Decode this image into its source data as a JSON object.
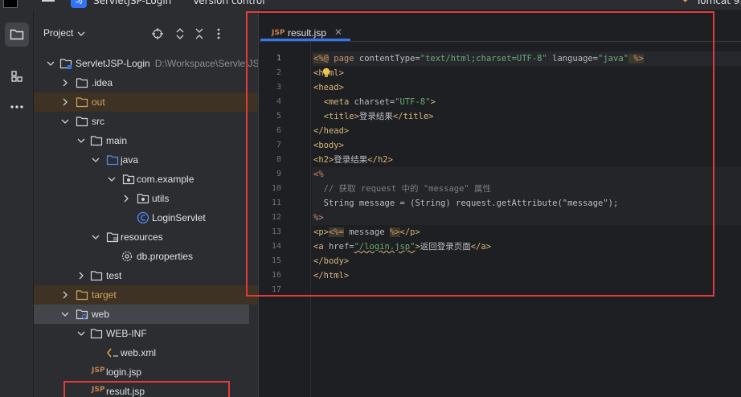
{
  "topbar": {
    "project_badge": "SJ",
    "project_name": "ServletJSP-Login",
    "vcs_label": "Version control",
    "run_config": "Tomcat 9."
  },
  "project_panel": {
    "title": "Project",
    "tree": [
      {
        "label": "ServletJSP-Login",
        "path": "D:\\Workspace\\ServletJSP",
        "type": "module",
        "expanded": true
      },
      {
        "label": ".idea",
        "type": "folder",
        "expanded": false
      },
      {
        "label": "out",
        "type": "folder-excluded",
        "expanded": false
      },
      {
        "label": "src",
        "type": "folder",
        "expanded": true
      },
      {
        "label": "main",
        "type": "folder",
        "expanded": true
      },
      {
        "label": "java",
        "type": "source-root",
        "expanded": true
      },
      {
        "label": "com.example",
        "type": "package",
        "expanded": true
      },
      {
        "label": "utils",
        "type": "package",
        "expanded": false
      },
      {
        "label": "LoginServlet",
        "type": "class"
      },
      {
        "label": "resources",
        "type": "resources-root",
        "expanded": true
      },
      {
        "label": "db.properties",
        "type": "properties"
      },
      {
        "label": "test",
        "type": "folder",
        "expanded": false
      },
      {
        "label": "target",
        "type": "folder-excluded",
        "expanded": false
      },
      {
        "label": "web",
        "type": "folder",
        "expanded": true
      },
      {
        "label": "WEB-INF",
        "type": "folder",
        "expanded": true
      },
      {
        "label": "web.xml",
        "type": "xml"
      },
      {
        "label": "login.jsp",
        "type": "jsp"
      },
      {
        "label": "result.jsp",
        "type": "jsp"
      }
    ]
  },
  "editor": {
    "tab_label": "result.jsp",
    "tab_file_type": "JSP",
    "lines": [
      "1",
      "2",
      "3",
      "4",
      "5",
      "6",
      "7",
      "8",
      "9",
      "10",
      "11",
      "12",
      "13",
      "14",
      "15",
      "16",
      "17"
    ],
    "code": {
      "l1_dir_open": "<%@",
      "l1_kw": " page ",
      "l1_attr1": "contentType=",
      "l1_str1": "\"text/html;charset=UTF-8\"",
      "l1_attr2": " language=",
      "l1_str2": "\"java\"",
      "l1_dir_close": " %>",
      "l2": "<html>",
      "l3": "<head>",
      "l4_tag_open": "<meta",
      "l4_attr": " charset=",
      "l4_str": "\"UTF-8\"",
      "l4_tag_close": ">",
      "l5_open": "<title>",
      "l5_text": "登录结果",
      "l5_close": "</title>",
      "l6": "</head>",
      "l7": "<body>",
      "l8_open": "<h2>",
      "l8_text": "登录结果",
      "l8_close": "</h2>",
      "l9": "<%",
      "l10": "// 获取 request 中的 \"message\" 属性",
      "l11": "String message = (String) request.getAttribute(\"message\");",
      "l12": "%>",
      "l13_open": "<p>",
      "l13_expr_open": "<%=",
      "l13_expr": " message ",
      "l13_expr_close": "%>",
      "l13_close": "</p>",
      "l14_open": "<a",
      "l14_attr": " href=",
      "l14_str": "\"/login.jsp\"",
      "l14_gt": ">",
      "l14_text": "返回登录页面",
      "l14_close": "</a>",
      "l15": "</body>",
      "l16": "</html>"
    }
  },
  "colors": {
    "accent": "#3574f0",
    "annotation_red": "#e23b3b"
  }
}
